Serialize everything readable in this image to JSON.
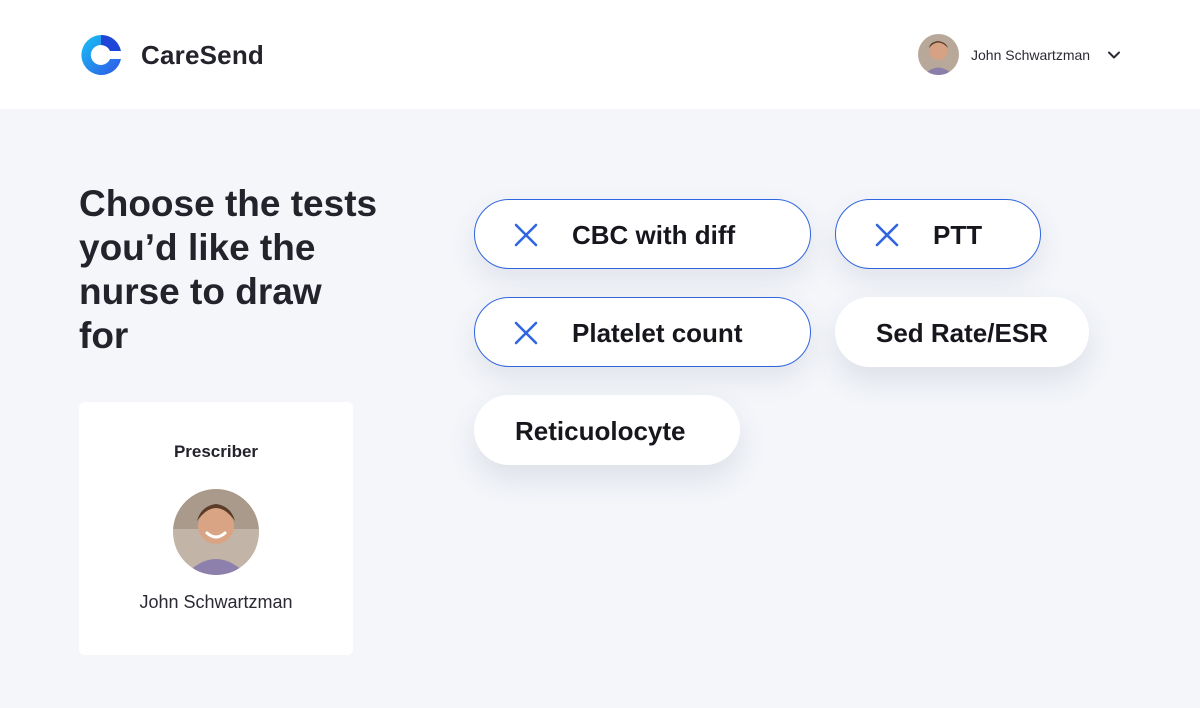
{
  "app": {
    "brand_name": "CareSend",
    "accent_color": "#2f66e0"
  },
  "header": {
    "user": {
      "name": "John Schwartzman",
      "avatar_icon": "user-avatar"
    },
    "menu_icon": "chevron-down-icon"
  },
  "main": {
    "heading": "Choose the tests you’d like the nurse to draw for",
    "prescriber": {
      "label": "Prescriber",
      "name": "John Schwartzman"
    },
    "tests": [
      {
        "label": "CBC with diff",
        "selected": true
      },
      {
        "label": "PTT",
        "selected": true
      },
      {
        "label": "Platelet count",
        "selected": true
      },
      {
        "label": "Sed Rate/ESR",
        "selected": false
      },
      {
        "label": "Reticuolocyte",
        "selected": false
      }
    ]
  }
}
